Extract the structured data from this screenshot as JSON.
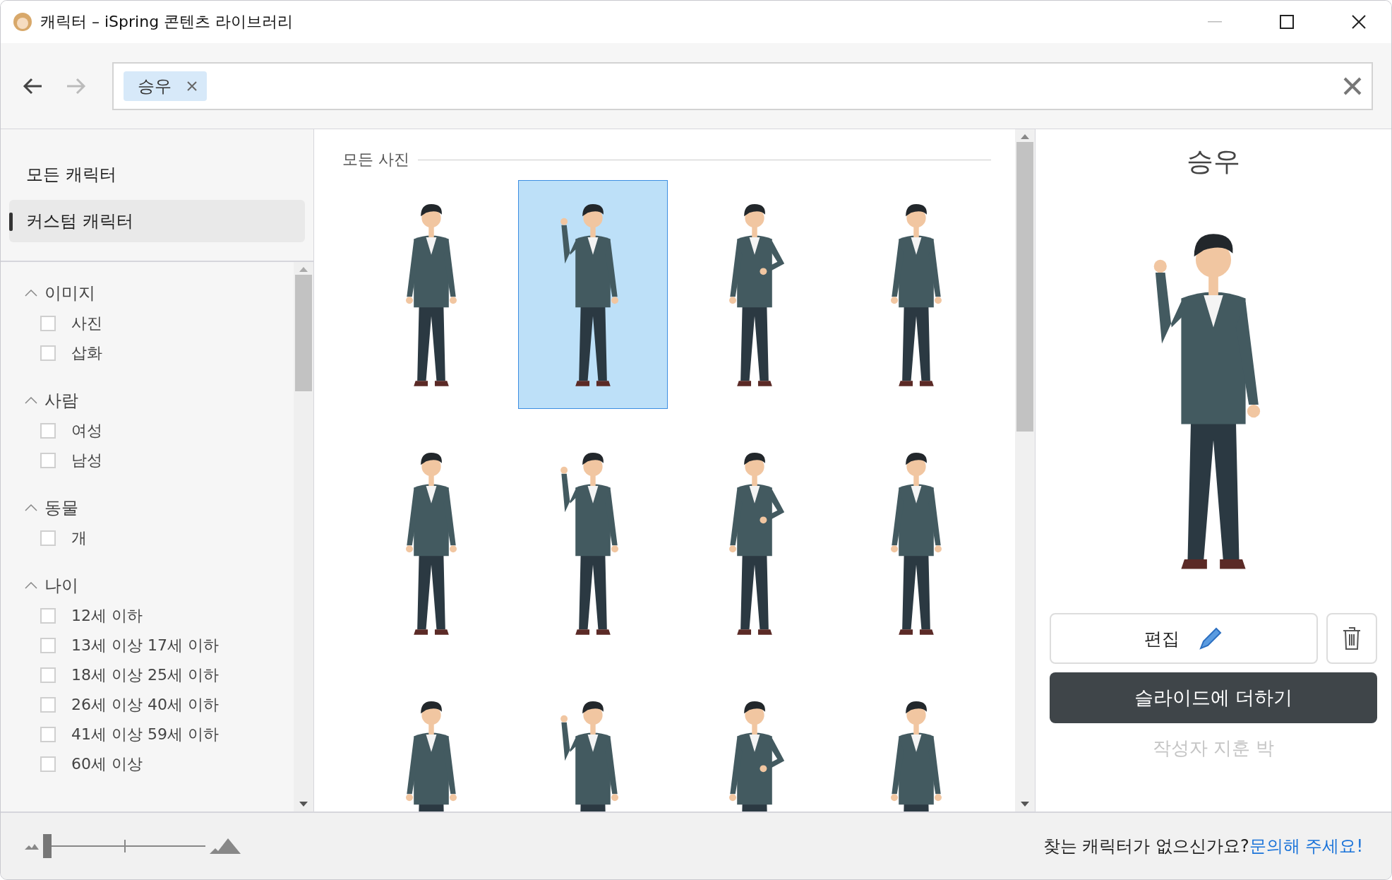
{
  "window": {
    "title": "캐릭터 – iSpring 콘텐츠 라이브러리"
  },
  "nav": [
    {
      "kind": "back",
      "disabled": false
    },
    {
      "kind": "forward",
      "disabled": true
    }
  ],
  "search": {
    "tags": [
      {
        "label": "승우"
      }
    ]
  },
  "categories": [
    {
      "label": "모든 캐릭터",
      "selected": false
    },
    {
      "label": "커스텀 캐릭터",
      "selected": true
    }
  ],
  "filters": [
    {
      "title": "이미지",
      "expanded": true,
      "options": [
        {
          "label": "사진",
          "checked": false
        },
        {
          "label": "삽화",
          "checked": false
        }
      ]
    },
    {
      "title": "사람",
      "expanded": true,
      "options": [
        {
          "label": "여성",
          "checked": false
        },
        {
          "label": "남성",
          "checked": false
        }
      ]
    },
    {
      "title": "동물",
      "expanded": true,
      "options": [
        {
          "label": "개",
          "checked": false
        }
      ]
    },
    {
      "title": "나이",
      "expanded": true,
      "options": [
        {
          "label": "12세 이하",
          "checked": false
        },
        {
          "label": "13세 이상 17세 이하",
          "checked": false
        },
        {
          "label": "18세 이상 25세 이하",
          "checked": false
        },
        {
          "label": "26세 이상 40세 이하",
          "checked": false
        },
        {
          "label": "41세 이상 59세 이하",
          "checked": false
        },
        {
          "label": "60세 이상",
          "checked": false
        }
      ]
    }
  ],
  "gallery": {
    "heading": "모든 사진",
    "items": [
      {
        "selected": false
      },
      {
        "selected": true
      },
      {
        "selected": false
      },
      {
        "selected": false
      },
      {
        "selected": false
      },
      {
        "selected": false
      },
      {
        "selected": false
      },
      {
        "selected": false
      },
      {
        "selected": false
      },
      {
        "selected": false
      },
      {
        "selected": false
      },
      {
        "selected": false
      }
    ]
  },
  "detail": {
    "name": "승우",
    "edit_label": "편집",
    "add_label": "슬라이드에 더하기",
    "author": "작성자 지훈 박"
  },
  "footer": {
    "size_slider": {
      "level": 0
    },
    "prompt": "찾는 캐릭터가 없으신가요?",
    "link": "문의해 주세요!"
  }
}
